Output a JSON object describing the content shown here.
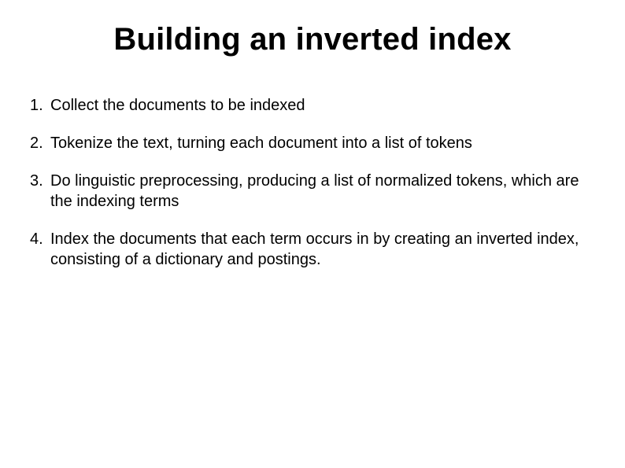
{
  "title": "Building an inverted index",
  "items": [
    "Collect the documents to be indexed",
    "Tokenize the text, turning each document into a list of tokens",
    "Do linguistic preprocessing, producing a list of normalized tokens, which are the indexing terms",
    "Index the documents that each term occurs in by creating an inverted index, consisting of a dictionary and postings."
  ]
}
